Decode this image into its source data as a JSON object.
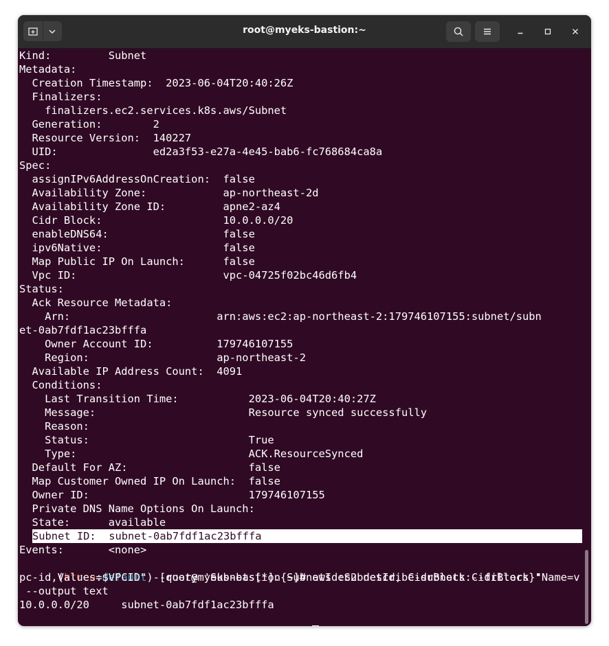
{
  "window": {
    "title": "root@myeks-bastion:~"
  },
  "colors": {
    "background": "#300a24",
    "text": "#ffffff",
    "prompt_red": "#d94a3b",
    "prompt_blue": "#3fa3c7",
    "titlebar": "#2c2c2c"
  },
  "icons": [
    "new-tab-icon",
    "chevron-down-icon",
    "search-icon",
    "hamburger-menu-icon",
    "minimize-icon",
    "maximize-icon",
    "close-icon"
  ],
  "terminal": {
    "lines": [
      "Kind:         Subnet",
      "Metadata:",
      "  Creation Timestamp:  2023-06-04T20:40:26Z",
      "  Finalizers:",
      "    finalizers.ec2.services.k8s.aws/Subnet",
      "  Generation:        2",
      "  Resource Version:  140227",
      "  UID:               ed2a3f53-e27a-4e45-bab6-fc768684ca8a",
      "Spec:",
      "  assignIPv6AddressOnCreation:  false",
      "  Availability Zone:            ap-northeast-2d",
      "  Availability Zone ID:         apne2-az4",
      "  Cidr Block:                   10.0.0.0/20",
      "  enableDNS64:                  false",
      "  ipv6Native:                   false",
      "  Map Public IP On Launch:      false",
      "  Vpc ID:                       vpc-04725f02bc46d6fb4",
      "Status:",
      "  Ack Resource Metadata:",
      "    Arn:                       arn:aws:ec2:ap-northeast-2:179746107155:subnet/subn",
      "et-0ab7fdf1ac23bfffa",
      "    Owner Account ID:          179746107155",
      "    Region:                    ap-northeast-2",
      "  Available IP Address Count:  4091",
      "  Conditions:",
      "    Last Transition Time:           2023-06-04T20:40:27Z",
      "    Message:                        Resource synced successfully",
      "    Reason:",
      "    Status:                         True",
      "    Type:                           ACK.ResourceSynced",
      "  Default For AZ:                   false",
      "  Map Customer Owned IP On Launch:  false",
      "  Owner ID:                         179746107155",
      "  Private DNS Name Options On Launch:",
      "  State:      available",
      "  Subnet ID:  subnet-0ab7fdf1ac23bfffa",
      "Events:       <none>"
    ],
    "selected_line_index": 35,
    "prompt": {
      "open_paren": "(",
      "cluster": "ktree",
      "colon": ":",
      "namespace": "default",
      "close": ") [root@myeks-bastion ~]# "
    },
    "command_lines": [
      "aws ec2 describe-subnets --filters \"Name=v",
      "pc-id,Values=$VPCID\" --query 'Subnets[*].{SubnetId:SubnetId, CidrBlock:CidrBlock}'",
      " --output text"
    ],
    "output_line": "10.0.0.0/20     subnet-0ab7fdf1ac23bfffa"
  }
}
